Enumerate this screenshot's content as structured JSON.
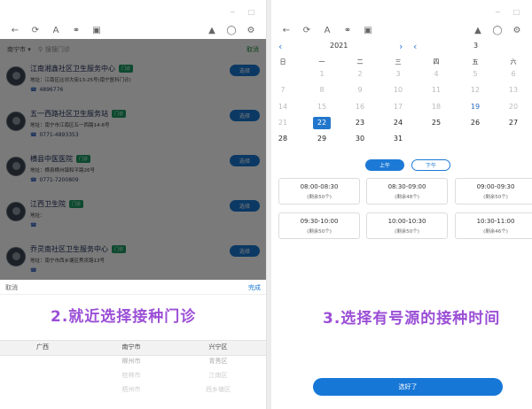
{
  "left": {
    "city": "南宁市",
    "search_placeholder": "搜搜门诊",
    "cancel_top": "取消",
    "choose_label": "选择",
    "tag_label": "门诊",
    "items": [
      {
        "name": "江南湘鑫社区卫生服务中心",
        "addr": "地址：江南区比邻大街13-25号(南宁医科门诊)",
        "phone": "4896776"
      },
      {
        "name": "五一西路社区卫生服务站",
        "addr": "地址：南宁市江南区五一西路14-6号",
        "phone": "0771-4893353"
      },
      {
        "name": "横县中医医院",
        "addr": "地址：横县横州镇和平路26号",
        "phone": "0771-7200809"
      },
      {
        "name": "江西卫生院",
        "addr": "地址：",
        "phone": ""
      },
      {
        "name": "乔灵南社区卫生服务中心",
        "addr": "地址：南宁市西乡塘区秀灵路13号",
        "phone": ""
      }
    ],
    "picker_cancel": "取消",
    "picker_done": "完成",
    "caption": "2.就近选择接种门诊",
    "col_province": [
      "广西"
    ],
    "col_city": [
      "南宁市",
      "柳州市",
      "桂林市",
      "梧州市"
    ],
    "col_district": [
      "兴宁区",
      "青秀区",
      "江南区",
      "西乡塘区"
    ]
  },
  "right": {
    "year": "2021",
    "month": "3",
    "weekdays": [
      "日",
      "一",
      "二",
      "三",
      "四",
      "五",
      "六"
    ],
    "days": [
      [
        "",
        "1",
        "2",
        "3",
        "4",
        "5",
        "6"
      ],
      [
        "7",
        "8",
        "9",
        "10",
        "11",
        "12",
        "13"
      ],
      [
        "14",
        "15",
        "16",
        "17",
        "18",
        "19",
        "20"
      ],
      [
        "21",
        "22",
        "23",
        "24",
        "25",
        "26",
        "27"
      ],
      [
        "28",
        "29",
        "30",
        "31",
        "",
        "",
        ""
      ]
    ],
    "am_label": "上午",
    "pm_label": "下午",
    "slots": [
      {
        "time": "08:00-08:30",
        "remain": "(剩余50个)"
      },
      {
        "time": "08:30-09:00",
        "remain": "(剩余48个)"
      },
      {
        "time": "09:00-09:30",
        "remain": "(剩余50个)"
      },
      {
        "time": "09:30-10:00",
        "remain": "(剩余50个)"
      },
      {
        "time": "10:00-10:30",
        "remain": "(剩余50个)"
      },
      {
        "time": "10:30-11:00",
        "remain": "(剩余46个)"
      }
    ],
    "caption": "3.选择有号源的接种时间",
    "ok_label": "选好了"
  },
  "icons": [
    "back-arrow-icon",
    "refresh-icon",
    "font-icon",
    "link-icon",
    "calendar-icon",
    "share-icon",
    "settings-icon",
    "gear-icon",
    "minimize-icon",
    "restore-icon",
    "close-icon",
    "search-icon",
    "phone-icon",
    "chevron-left-icon",
    "chevron-right-icon"
  ]
}
